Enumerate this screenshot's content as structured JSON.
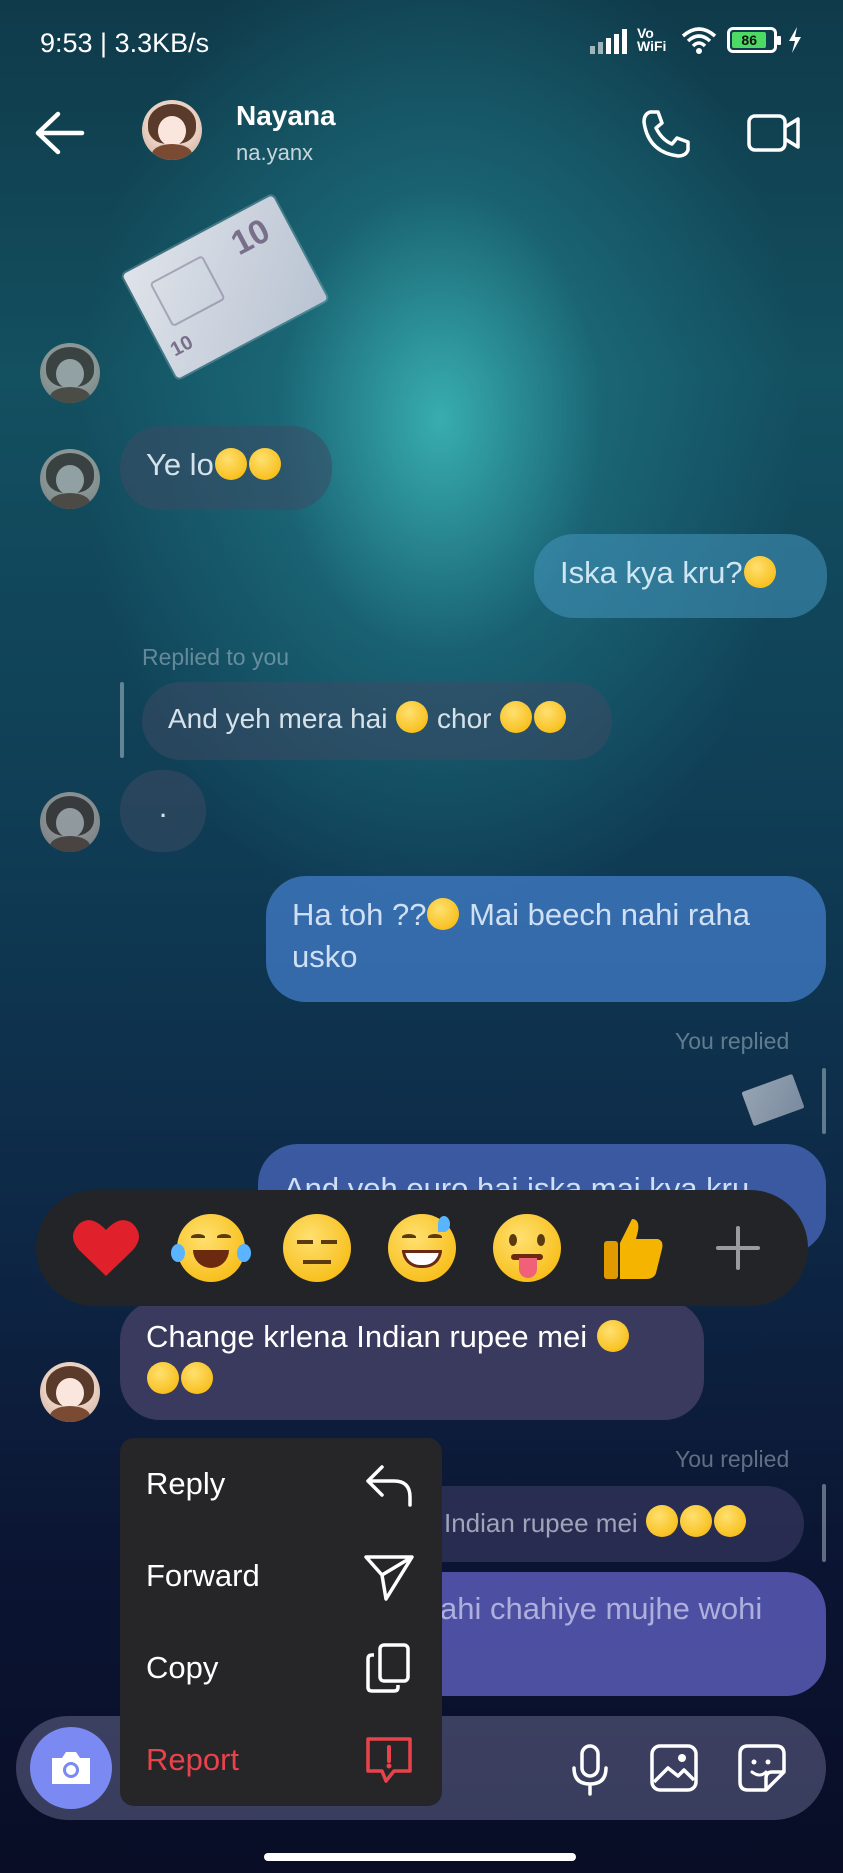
{
  "status_bar": {
    "time": "9:53 | 3.3KB/s",
    "network": "Vo WiFi",
    "battery": "86"
  },
  "header": {
    "name": "Nayana",
    "username": "na.yanx"
  },
  "messages": {
    "m1_text": "Ye lo",
    "m2_text": "Iska kya kru?",
    "m3_reply_label": "Replied to you",
    "m3_text": "And yeh mera hai",
    "m3_text_tail": "chor",
    "m4_text": ".",
    "m5_text": "Ha toh ??",
    "m5_text_tail": "Mai beech nahi raha usko",
    "m6_reply_label": "You replied",
    "m6_text": "And yeh euro hai iska mai kya kru",
    "m7_text": "Change krlena Indian rupee mei",
    "m8_reply_label": "You replied",
    "m8_quote": "Indian rupee mei",
    "m8_text": "ahi chahiye mujhe wohi"
  },
  "reactions": [
    "heart",
    "tears-of-joy",
    "expressionless",
    "grinning-sweat",
    "tongue",
    "thumbs-up"
  ],
  "menu": {
    "reply": "Reply",
    "forward": "Forward",
    "copy": "Copy",
    "report": "Report"
  },
  "colors": {
    "report_red": "#e8434b",
    "camera_button": "#7b8af2"
  }
}
